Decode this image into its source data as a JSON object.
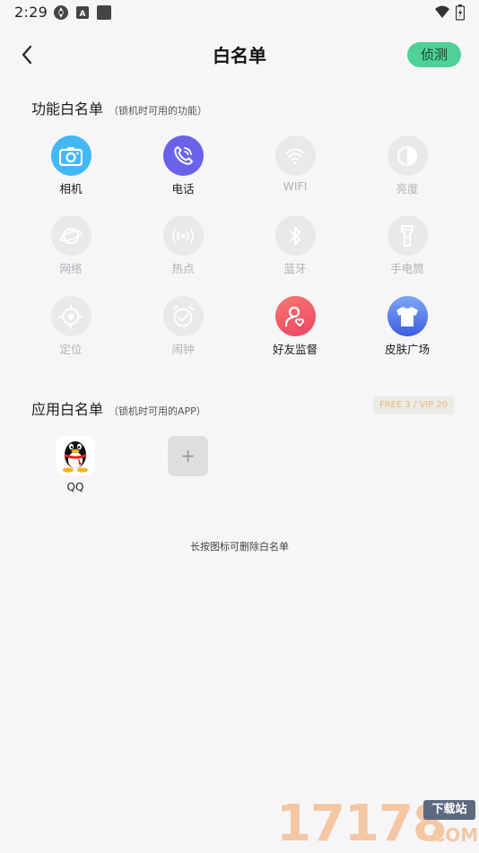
{
  "status_bar": {
    "time": "2:29",
    "icons": [
      "app-icon",
      "a-icon",
      "square-icon",
      "wifi-icon",
      "battery-icon"
    ]
  },
  "header": {
    "title": "白名单",
    "back_icon": "chevron-left-icon",
    "detect_label": "侦测",
    "detect_color": "#4ed197"
  },
  "feature_section": {
    "title": "功能白名单",
    "subtitle": "（锁机时可用的功能）",
    "items": [
      {
        "label": "相机",
        "icon": "camera-icon",
        "active": true,
        "color": "#44b8f5"
      },
      {
        "label": "电话",
        "icon": "phone-icon",
        "active": true,
        "color": "#6a63ea"
      },
      {
        "label": "WIFI",
        "icon": "wifi-icon",
        "active": false
      },
      {
        "label": "亮度",
        "icon": "brightness-icon",
        "active": false
      },
      {
        "label": "网络",
        "icon": "planet-icon",
        "active": false
      },
      {
        "label": "热点",
        "icon": "hotspot-icon",
        "active": false
      },
      {
        "label": "蓝牙",
        "icon": "bluetooth-icon",
        "active": false
      },
      {
        "label": "手电筒",
        "icon": "flashlight-icon",
        "active": false
      },
      {
        "label": "定位",
        "icon": "location-icon",
        "active": false
      },
      {
        "label": "闹钟",
        "icon": "alarm-icon",
        "active": false
      },
      {
        "label": "好友监督",
        "icon": "friend-icon",
        "active": true,
        "color": "#f05a6a"
      },
      {
        "label": "皮肤广场",
        "icon": "tshirt-icon",
        "active": true,
        "color": "#3f6ee8"
      }
    ]
  },
  "app_section": {
    "title": "应用白名单",
    "subtitle": "（锁机时可用的APP）",
    "badge": "FREE 3 / VIP 20",
    "apps": [
      {
        "label": "QQ",
        "icon": "qq-penguin-icon"
      }
    ],
    "add_label": "+"
  },
  "hint": "长按图标可删除白名单",
  "watermark": {
    "digits": "17178",
    "tag": "下载站",
    "domain": ".COM"
  }
}
